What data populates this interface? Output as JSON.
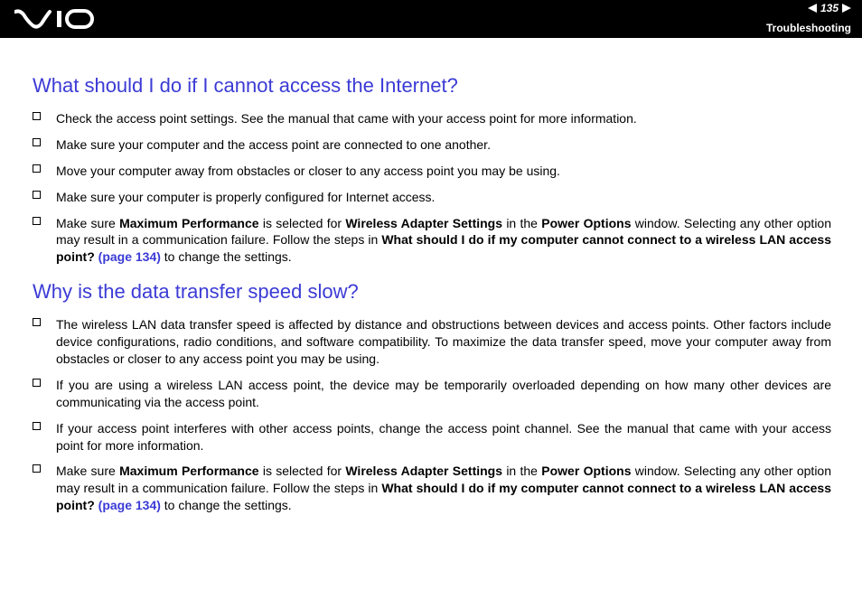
{
  "header": {
    "page_number": "135",
    "section": "Troubleshooting"
  },
  "q1": {
    "title": "What should I do if I cannot access the Internet?",
    "items": [
      {
        "plain": "Check the access point settings. See the manual that came with your access point for more information."
      },
      {
        "plain": "Make sure your computer and the access point are connected to one another."
      },
      {
        "plain": "Move your computer away from obstacles or closer to any access point you may be using."
      },
      {
        "plain": "Make sure your computer is properly configured for Internet access."
      },
      {
        "t1": "Make sure ",
        "b1": "Maximum Performance",
        "t2": " is selected for ",
        "b2": "Wireless Adapter Settings",
        "t3": " in the ",
        "b3": "Power Options",
        "t4": " window. Selecting any other option may result in a communication failure. Follow the steps in ",
        "b4": "What should I do if my computer cannot connect to a wireless LAN access point? ",
        "link": "(page 134)",
        "t5": " to change the settings."
      }
    ]
  },
  "q2": {
    "title": "Why is the data transfer speed slow?",
    "items": [
      {
        "plain": "The wireless LAN data transfer speed is affected by distance and obstructions between devices and access points. Other factors include device configurations, radio conditions, and software compatibility. To maximize the data transfer speed, move your computer away from obstacles or closer to any access point you may be using."
      },
      {
        "plain": "If you are using a wireless LAN access point, the device may be temporarily overloaded depending on how many other devices are communicating via the access point."
      },
      {
        "plain": "If your access point interferes with other access points, change the access point channel. See the manual that came with your access point for more information."
      },
      {
        "t1": "Make sure ",
        "b1": "Maximum Performance",
        "t2": " is selected for ",
        "b2": "Wireless Adapter Settings",
        "t3": " in the ",
        "b3": "Power Options",
        "t4": " window. Selecting any other option may result in a communication failure. Follow the steps in ",
        "b4": "What should I do if my computer cannot connect to a wireless LAN access point? ",
        "link": "(page 134)",
        "t5": " to change the settings."
      }
    ]
  }
}
